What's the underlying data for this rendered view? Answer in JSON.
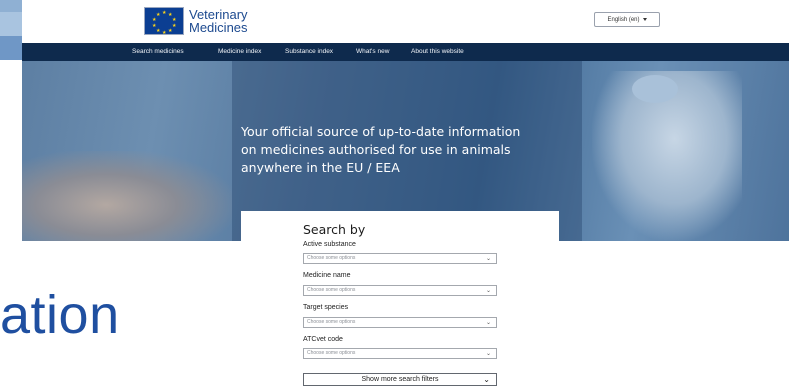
{
  "slide": {
    "partial_heading": "ation"
  },
  "site": {
    "logo": {
      "line1": "Veterinary",
      "line2": "Medicines"
    },
    "language": {
      "selected": "English (en)"
    },
    "nav": [
      {
        "label": "Search medicines"
      },
      {
        "label": "Medicine index"
      },
      {
        "label": "Substance index"
      },
      {
        "label": "What's new"
      },
      {
        "label": "About this website"
      }
    ],
    "hero": {
      "line1": "Your official source of up-to-date information",
      "line2": "on medicines authorised for use in animals",
      "line3": "anywhere in the EU / EEA"
    },
    "search": {
      "title": "Search by",
      "fields": [
        {
          "label": "Active substance",
          "placeholder": "Choose some options"
        },
        {
          "label": "Medicine name",
          "placeholder": "Choose some options"
        },
        {
          "label": "Target species",
          "placeholder": "Choose some options"
        },
        {
          "label": "ATCvet code",
          "placeholder": "Choose some options"
        }
      ],
      "more_filters_label": "Show more search filters"
    }
  },
  "colors": {
    "nav_bg": "#0e2a4d",
    "brand_blue": "#1d4a8f",
    "slide_text_blue": "#1f4fa0"
  }
}
